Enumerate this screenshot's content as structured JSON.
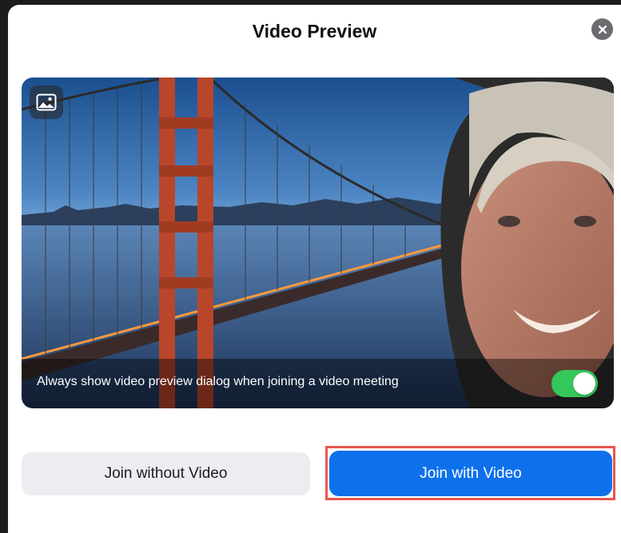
{
  "dialog": {
    "title": "Video Preview",
    "close_icon": "close-icon"
  },
  "preview": {
    "background_icon": "image-icon",
    "always_show_label": "Always show video preview dialog when joining a video meeting",
    "always_show_enabled": true
  },
  "actions": {
    "join_without_video_label": "Join without Video",
    "join_with_video_label": "Join with Video"
  },
  "colors": {
    "primary": "#0e71eb",
    "toggle_on": "#34c759",
    "highlight": "#e8574f"
  }
}
